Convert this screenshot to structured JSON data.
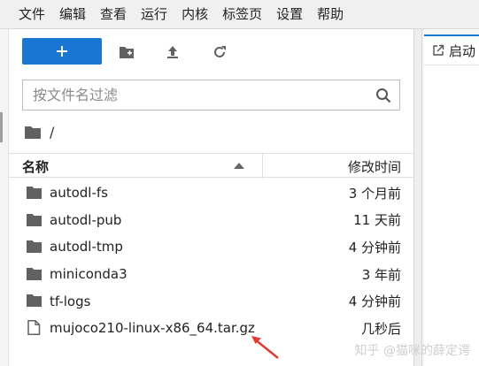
{
  "menu": [
    "文件",
    "编辑",
    "查看",
    "运行",
    "内核",
    "标签页",
    "设置",
    "帮助"
  ],
  "search": {
    "placeholder": "按文件名过滤"
  },
  "breadcrumb": {
    "path": "/"
  },
  "table": {
    "col_name": "名称",
    "col_modified": "修改时间",
    "rows": [
      {
        "name": "autodl-fs",
        "modified": "3 个月前",
        "type": "folder"
      },
      {
        "name": "autodl-pub",
        "modified": "11 天前",
        "type": "folder"
      },
      {
        "name": "autodl-tmp",
        "modified": "4 分钟前",
        "type": "folder"
      },
      {
        "name": "miniconda3",
        "modified": "3 年前",
        "type": "folder"
      },
      {
        "name": "tf-logs",
        "modified": "4 分钟前",
        "type": "folder"
      },
      {
        "name": "mujoco210-linux-x86_64.tar.gz",
        "modified": "几秒后",
        "type": "file"
      }
    ]
  },
  "launcher_tab": {
    "label": "启动"
  },
  "watermark": "知乎 @猫咪的薛定谔",
  "colors": {
    "accent": "#1976d2",
    "annotation_arrow": "#e53935"
  },
  "icons": [
    "plus-icon",
    "new-folder-icon",
    "upload-icon",
    "refresh-icon",
    "search-icon",
    "folder-icon",
    "file-icon",
    "launch-icon",
    "sort-ascending-icon",
    "annotation-arrow"
  ]
}
